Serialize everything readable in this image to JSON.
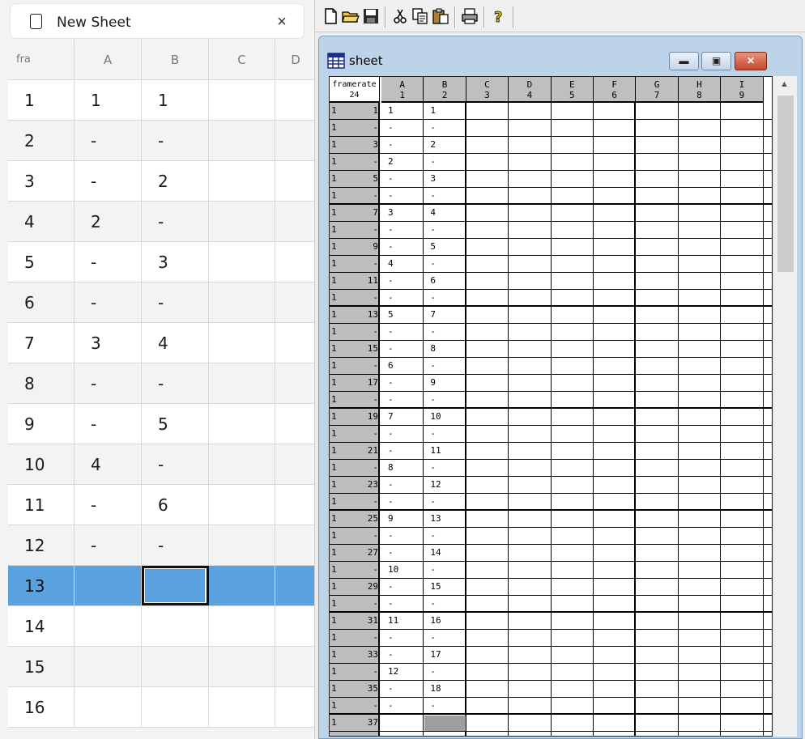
{
  "left_tab": {
    "title": "New Sheet",
    "close_glyph": "×"
  },
  "left_sheet": {
    "headers": [
      "fra",
      "A",
      "B",
      "C",
      "D"
    ],
    "rows": [
      [
        "1",
        "1",
        "1",
        "",
        ""
      ],
      [
        "2",
        "-",
        "-",
        "",
        ""
      ],
      [
        "3",
        "-",
        "2",
        "",
        ""
      ],
      [
        "4",
        "2",
        "-",
        "",
        ""
      ],
      [
        "5",
        "-",
        "3",
        "",
        ""
      ],
      [
        "6",
        "-",
        "-",
        "",
        ""
      ],
      [
        "7",
        "3",
        "4",
        "",
        ""
      ],
      [
        "8",
        "-",
        "-",
        "",
        ""
      ],
      [
        "9",
        "-",
        "5",
        "",
        ""
      ],
      [
        "10",
        "4",
        "-",
        "",
        ""
      ],
      [
        "11",
        "-",
        "6",
        "",
        ""
      ],
      [
        "12",
        "-",
        "-",
        "",
        ""
      ],
      [
        "13",
        "",
        "",
        "",
        ""
      ],
      [
        "14",
        "",
        "",
        "",
        ""
      ],
      [
        "15",
        "",
        "",
        "",
        ""
      ],
      [
        "16",
        "",
        "",
        "",
        ""
      ]
    ],
    "selected_row": 13,
    "active_column": "B",
    "selection_color": "#5aa1e0"
  },
  "toolbar": {
    "items": [
      "new-file-icon",
      "open-folder-icon",
      "save-disk-icon",
      "cut-scissors-icon",
      "copy-icon",
      "paste-icon",
      "print-icon",
      "help-icon"
    ]
  },
  "sheet_window": {
    "title": "sheet",
    "titlebar_color": "#bcd3ea",
    "buttons": [
      "minimize",
      "maximize",
      "close"
    ],
    "framerate_label": "framerate",
    "framerate_value": "24",
    "columns": [
      {
        "name": "A",
        "num": "1"
      },
      {
        "name": "B",
        "num": "2"
      },
      {
        "name": "C",
        "num": "3"
      },
      {
        "name": "D",
        "num": "4"
      },
      {
        "name": "E",
        "num": "5"
      },
      {
        "name": "F",
        "num": "6"
      },
      {
        "name": "G",
        "num": "7"
      },
      {
        "name": "H",
        "num": "8"
      },
      {
        "name": "I",
        "num": "9"
      }
    ],
    "rows": [
      {
        "f1": "1",
        "f2": "1",
        "A": "1",
        "B": "1"
      },
      {
        "f1": "1",
        "f2": "-",
        "A": "-",
        "B": "-"
      },
      {
        "f1": "1",
        "f2": "3",
        "A": "-",
        "B": "2"
      },
      {
        "f1": "1",
        "f2": "-",
        "A": "2",
        "B": "-"
      },
      {
        "f1": "1",
        "f2": "5",
        "A": "-",
        "B": "3"
      },
      {
        "f1": "1",
        "f2": "-",
        "A": "-",
        "B": "-"
      },
      {
        "f1": "1",
        "f2": "7",
        "A": "3",
        "B": "4"
      },
      {
        "f1": "1",
        "f2": "-",
        "A": "-",
        "B": "-"
      },
      {
        "f1": "1",
        "f2": "9",
        "A": "-",
        "B": "5"
      },
      {
        "f1": "1",
        "f2": "-",
        "A": "4",
        "B": "-"
      },
      {
        "f1": "1",
        "f2": "11",
        "A": "-",
        "B": "6"
      },
      {
        "f1": "1",
        "f2": "-",
        "A": "-",
        "B": "-"
      },
      {
        "f1": "1",
        "f2": "13",
        "A": "5",
        "B": "7"
      },
      {
        "f1": "1",
        "f2": "-",
        "A": "-",
        "B": "-"
      },
      {
        "f1": "1",
        "f2": "15",
        "A": "-",
        "B": "8"
      },
      {
        "f1": "1",
        "f2": "-",
        "A": "6",
        "B": "-"
      },
      {
        "f1": "1",
        "f2": "17",
        "A": "-",
        "B": "9"
      },
      {
        "f1": "1",
        "f2": "-",
        "A": "-",
        "B": "-"
      },
      {
        "f1": "1",
        "f2": "19",
        "A": "7",
        "B": "10"
      },
      {
        "f1": "1",
        "f2": "-",
        "A": "-",
        "B": "-"
      },
      {
        "f1": "1",
        "f2": "21",
        "A": "-",
        "B": "11"
      },
      {
        "f1": "1",
        "f2": "-",
        "A": "8",
        "B": "-"
      },
      {
        "f1": "1",
        "f2": "23",
        "A": "-",
        "B": "12"
      },
      {
        "f1": "1",
        "f2": "-",
        "A": "-",
        "B": "-"
      },
      {
        "f1": "1",
        "f2": "25",
        "A": "9",
        "B": "13"
      },
      {
        "f1": "1",
        "f2": "-",
        "A": "-",
        "B": "-"
      },
      {
        "f1": "1",
        "f2": "27",
        "A": "-",
        "B": "14"
      },
      {
        "f1": "1",
        "f2": "-",
        "A": "10",
        "B": "-"
      },
      {
        "f1": "1",
        "f2": "29",
        "A": "-",
        "B": "15"
      },
      {
        "f1": "1",
        "f2": "-",
        "A": "-",
        "B": "-"
      },
      {
        "f1": "1",
        "f2": "31",
        "A": "11",
        "B": "16"
      },
      {
        "f1": "1",
        "f2": "-",
        "A": "-",
        "B": "-"
      },
      {
        "f1": "1",
        "f2": "33",
        "A": "-",
        "B": "17"
      },
      {
        "f1": "1",
        "f2": "-",
        "A": "12",
        "B": "-"
      },
      {
        "f1": "1",
        "f2": "35",
        "A": "-",
        "B": "18"
      },
      {
        "f1": "1",
        "f2": "-",
        "A": "-",
        "B": "-"
      },
      {
        "f1": "1",
        "f2": "37",
        "A": "",
        "B": ""
      }
    ],
    "selected_cell": {
      "row": 37,
      "column": "B"
    }
  }
}
